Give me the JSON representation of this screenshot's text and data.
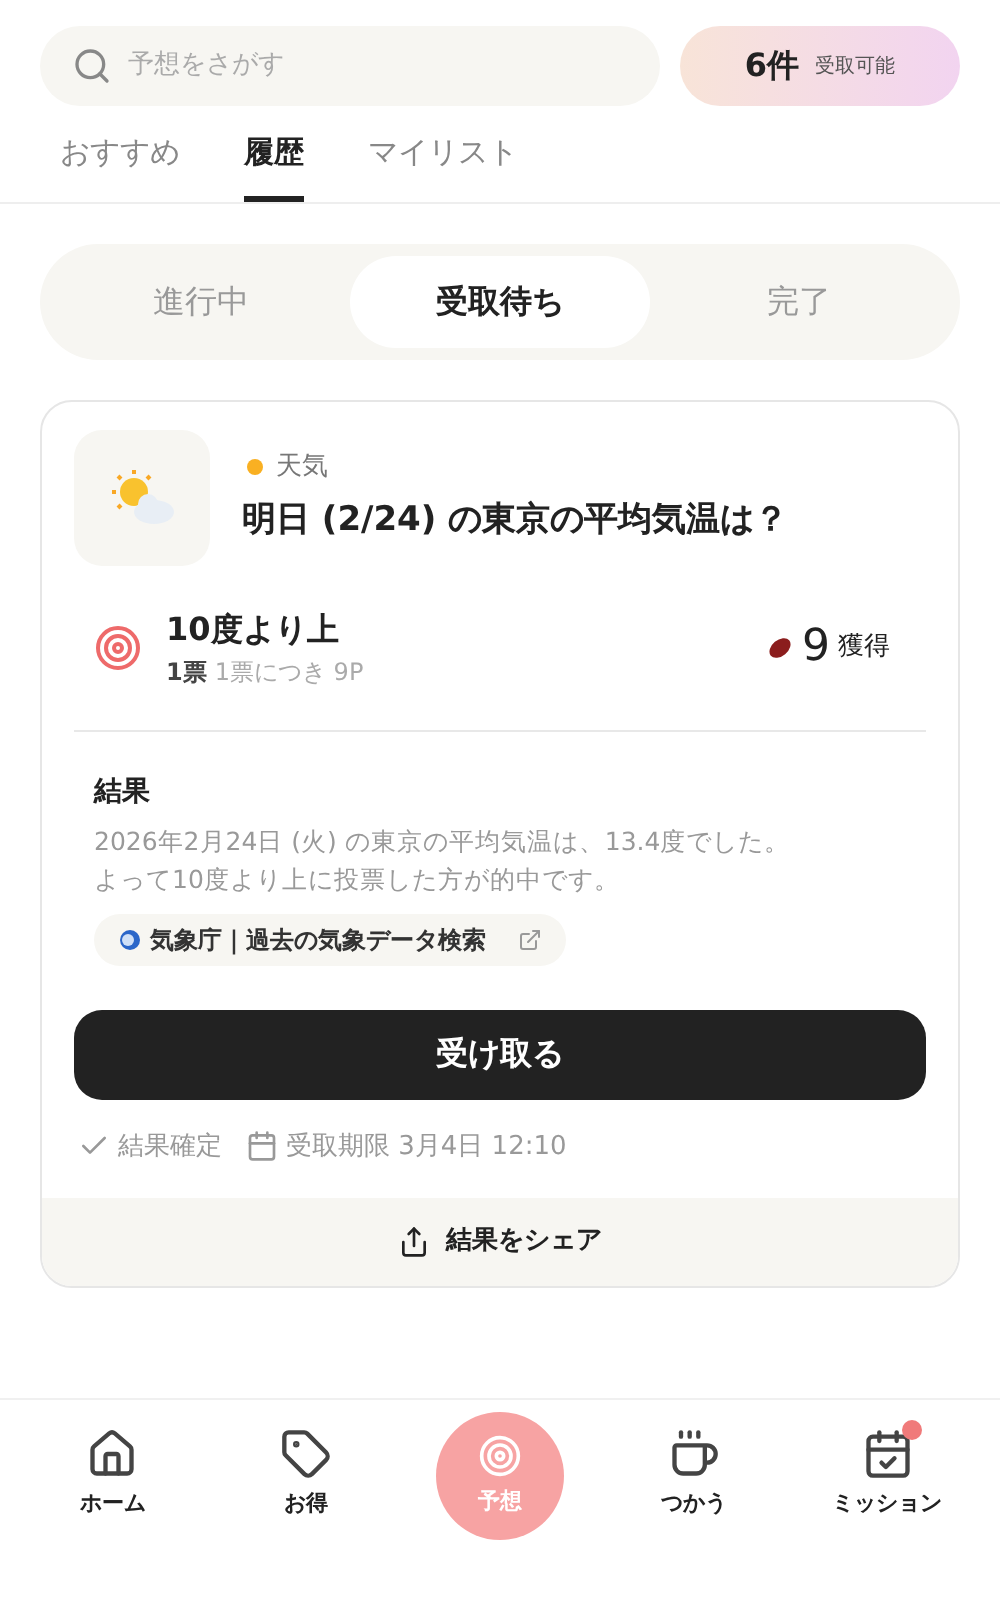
{
  "search": {
    "placeholder": "予想をさがす"
  },
  "claim_badge": {
    "count": "6件",
    "label": "受取可能"
  },
  "tabs": [
    {
      "label": "おすすめ",
      "selected": false
    },
    {
      "label": "履歴",
      "selected": true
    },
    {
      "label": "マイリスト",
      "selected": false
    }
  ],
  "segments": [
    {
      "label": "進行中",
      "selected": false
    },
    {
      "label": "受取待ち",
      "selected": true
    },
    {
      "label": "完了",
      "selected": false
    }
  ],
  "card": {
    "category": "天気",
    "title": "明日 (2/24) の東京の平均気温は？",
    "choice": "10度より上",
    "votes": "1票",
    "per_vote": "1票につき 9P",
    "reward": "9",
    "reward_label": "獲得",
    "result_heading": "結果",
    "result_lines": [
      "2026年2月24日 (火) の東京の平均気温は、13.4度でした。",
      "よって10度より上に投票した方が的中です。"
    ],
    "source_link": "気象庁｜過去の気象データ検索",
    "claim_button": "受け取る",
    "status": "結果確定",
    "deadline": "受取期限 3月4日 12:10",
    "share": "結果をシェア"
  },
  "nav": [
    {
      "kind": "home",
      "label": "ホーム",
      "selected": false,
      "notification": false
    },
    {
      "kind": "tag",
      "label": "お得",
      "selected": false,
      "notification": false
    },
    {
      "kind": "predict",
      "label": "予想",
      "selected": true,
      "notification": false
    },
    {
      "kind": "cup",
      "label": "つかう",
      "selected": false,
      "notification": false
    },
    {
      "kind": "mission",
      "label": "ミッション",
      "selected": false,
      "notification": true
    }
  ]
}
